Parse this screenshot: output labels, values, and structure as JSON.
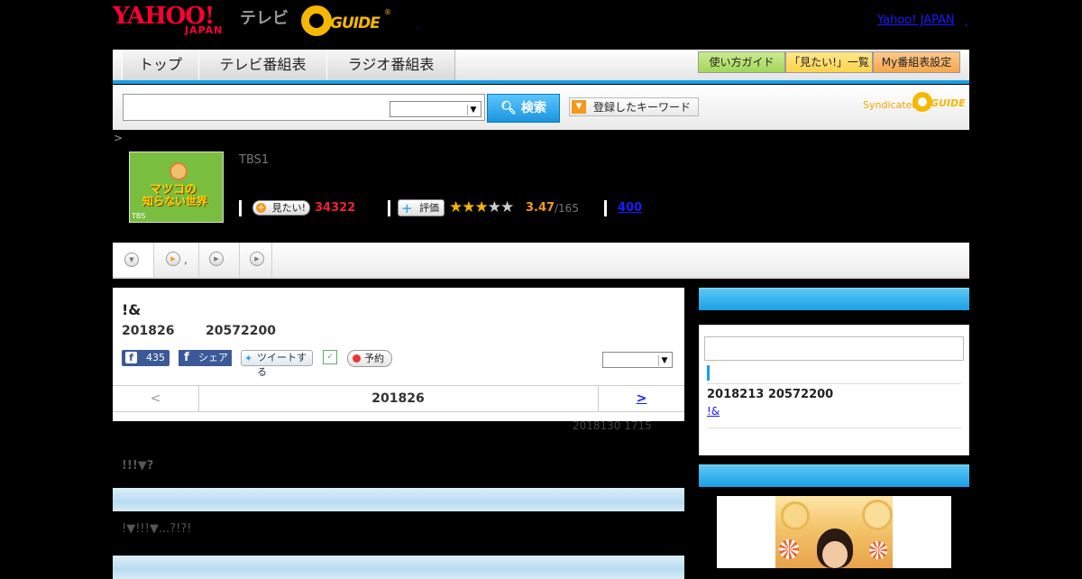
{
  "header": {
    "yahoo_logo": "YAHOO!",
    "yahoo_sub": "JAPAN",
    "tv_label": "テレビ",
    "gguide_text": "GUIDE",
    "gguide_reg": "®",
    "yahoo_japan_link": "Yahoo! JAPAN",
    "link_dot": ",",
    "tiny_dot": "."
  },
  "nav": {
    "tabs": [
      "トップ",
      "テレビ番組表",
      "ラジオ番組表"
    ],
    "buttons": [
      "使い方ガイド",
      "「見たい!」一覧",
      "My番組表設定"
    ],
    "button_colors": [
      "#a4d65a",
      "#ffd44a",
      "#f7a64a"
    ]
  },
  "search": {
    "input_value": "",
    "select_value": "",
    "search_label": "検索",
    "keyword_label": "登録したキーワード",
    "syndicated": "Syndicated",
    "syndicated_logo": "GUIDE"
  },
  "program": {
    "breadcrumb": ">",
    "thumb_line1": "マツコの",
    "thumb_line2": "知らない世界",
    "thumb_channel": "TBS",
    "channel": "TBS1",
    "mitai_label": "見たい!",
    "mitai_count": "34322",
    "rate_label": "評価",
    "score": "3.47",
    "score_count": "/165",
    "review_link": "400"
  },
  "tabs": {
    "tab2_text": ","
  },
  "episode": {
    "title": "!&",
    "date": "201826",
    "time": "20572200",
    "fb_like_count": "435",
    "fb_share": "シェア",
    "tweet": "ツイートする",
    "reserve": "予約",
    "select_value": "",
    "pager_prev": "<",
    "pager_current": "201826",
    "pager_next": ">",
    "updated": "2018130  1715",
    "desc1": "!!!▼?",
    "desc2": "!▼!!!▼...?!?!"
  },
  "side": {
    "input_value": "",
    "date": "2018213  20572200",
    "link": "!&"
  }
}
